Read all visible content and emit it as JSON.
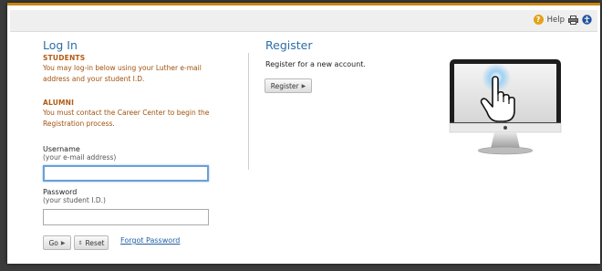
{
  "toolbar": {
    "help_label": "Help",
    "icons": [
      "help-icon",
      "print-icon",
      "accessibility-icon"
    ]
  },
  "login": {
    "title": "Log In",
    "students_heading": "STUDENTS",
    "students_text": "You may log-in below using your Luther e-mail address and your student I.D.",
    "alumni_heading": "ALUMNI",
    "alumni_text": "You must contact the Career Center to begin the Registration process.",
    "username_label": "Username",
    "username_hint": "(your e-mail address)",
    "username_value": "",
    "password_label": "Password",
    "password_hint": "(your student I.D.)",
    "password_value": "",
    "go_label": "Go",
    "reset_label": "Reset",
    "forgot_label": "Forgot Password"
  },
  "register": {
    "title": "Register",
    "description": "Register for a new account.",
    "button_label": "Register"
  },
  "colors": {
    "accent_top": "#c9850f",
    "title_blue": "#2b6ea8",
    "note_orange": "#a0520d"
  }
}
